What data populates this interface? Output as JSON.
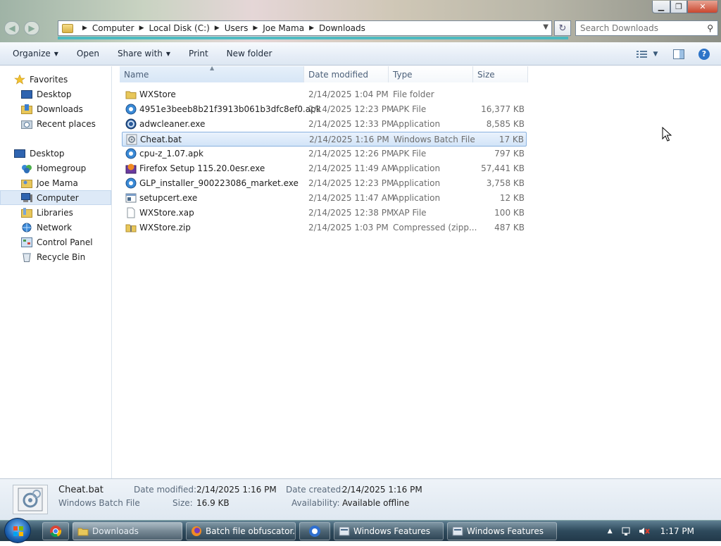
{
  "window": {
    "breadcrumb": [
      "Computer",
      "Local Disk (C:)",
      "Users",
      "Joe Mama",
      "Downloads"
    ],
    "search_placeholder": "Search Downloads"
  },
  "toolbar": {
    "organize": "Organize",
    "open": "Open",
    "share_with": "Share with",
    "print": "Print",
    "new_folder": "New folder"
  },
  "nav": {
    "favorites": "Favorites",
    "desktop": "Desktop",
    "downloads": "Downloads",
    "recent_places": "Recent places",
    "desktop_root": "Desktop",
    "homegroup": "Homegroup",
    "joe_mama": "Joe Mama",
    "computer": "Computer",
    "libraries": "Libraries",
    "network": "Network",
    "control_panel": "Control Panel",
    "recycle_bin": "Recycle Bin"
  },
  "columns": {
    "name": "Name",
    "date_modified": "Date modified",
    "type": "Type",
    "size": "Size"
  },
  "files": [
    {
      "name": "WXStore",
      "date": "2/14/2025 1:04 PM",
      "type": "File folder",
      "size": ""
    },
    {
      "name": "4951e3beeb8b21f3913b061b3dfc8ef0.apk",
      "date": "2/14/2025 12:23 PM",
      "type": "APK File",
      "size": "16,377 KB"
    },
    {
      "name": "adwcleaner.exe",
      "date": "2/14/2025 12:33 PM",
      "type": "Application",
      "size": "8,585 KB"
    },
    {
      "name": "Cheat.bat",
      "date": "2/14/2025 1:16 PM",
      "type": "Windows Batch File",
      "size": "17 KB"
    },
    {
      "name": "cpu-z_1.07.apk",
      "date": "2/14/2025 12:26 PM",
      "type": "APK File",
      "size": "797 KB"
    },
    {
      "name": "Firefox Setup 115.20.0esr.exe",
      "date": "2/14/2025 11:49 AM",
      "type": "Application",
      "size": "57,441 KB"
    },
    {
      "name": "GLP_installer_900223086_market.exe",
      "date": "2/14/2025 12:23 PM",
      "type": "Application",
      "size": "3,758 KB"
    },
    {
      "name": "setupcert.exe",
      "date": "2/14/2025 11:47 AM",
      "type": "Application",
      "size": "12 KB"
    },
    {
      "name": "WXStore.xap",
      "date": "2/14/2025 12:38 PM",
      "type": "XAP File",
      "size": "100 KB"
    },
    {
      "name": "WXStore.zip",
      "date": "2/14/2025 1:03 PM",
      "type": "Compressed (zipp...",
      "size": "487 KB"
    }
  ],
  "details": {
    "name": "Cheat.bat",
    "type": "Windows Batch File",
    "date_modified_label": "Date modified:",
    "date_modified": "2/14/2025 1:16 PM",
    "size_label": "Size:",
    "size": "16.9 KB",
    "date_created_label": "Date created:",
    "date_created": "2/14/2025 1:16 PM",
    "availability_label": "Availability:",
    "availability": "Available offline"
  },
  "taskbar": {
    "downloads": "Downloads",
    "batch": "Batch file obfuscator...",
    "winfeat1": "Windows Features",
    "winfeat2": "Windows Features",
    "clock": "1:17 PM"
  }
}
